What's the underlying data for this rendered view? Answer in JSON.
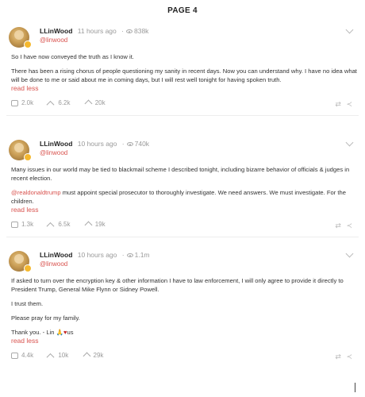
{
  "page_title": "PAGE 4",
  "posts": [
    {
      "name": "LLinWood",
      "time": "11 hours ago",
      "views": "838k",
      "handle": "@linwood",
      "paragraphs": [
        "So I have now conveyed the truth as I know it.",
        "There has been a rising chorus of people questioning my sanity in recent days. Now you can understand why. I have no idea what will be done to me or said about me in coming days, but I will rest well tonight for having spoken truth."
      ],
      "read_less": "read less",
      "comments": "2.0k",
      "echoes": "6.2k",
      "upvotes": "20k"
    },
    {
      "name": "LLinWood",
      "time": "10 hours ago",
      "views": "740k",
      "handle": "@linwood",
      "paragraphs": [
        "Many issues in our world may be tied to blackmail scheme I described tonight, including bizarre behavior of officials & judges in recent election."
      ],
      "mention": "@realdonaldtrump",
      "mention_text": " must appoint special prosecutor to thoroughly investigate. We need answers. We must investigate. For the children.",
      "read_less": "read less",
      "comments": "1.3k",
      "echoes": "6.5k",
      "upvotes": "19k"
    },
    {
      "name": "LLinWood",
      "time": "10 hours ago",
      "views": "1.1m",
      "handle": "@linwood",
      "paragraphs": [
        "If asked to turn over the encryption key & other information I have to law enforcement, I will only agree to provide it directly to President Trump, General Mike Flynn or Sidney Powell.",
        "I trust them.",
        "Please pray for my family."
      ],
      "signoff": "Thank you. - Lin ",
      "signoff_emoji": "🙏",
      "signoff_heart": "♥",
      "signoff_end": "us",
      "read_less": "read less",
      "comments": "4.4k",
      "echoes": "10k",
      "upvotes": "29k"
    }
  ],
  "icons": {
    "eye": "eye-icon",
    "comment": "comment-icon",
    "echo": "echo-icon",
    "upvote": "upvote-icon",
    "share": "share-icon",
    "chevron": "chevron-down-icon"
  },
  "colors": {
    "accent": "#d9534f",
    "meta": "#9a9a9a"
  }
}
